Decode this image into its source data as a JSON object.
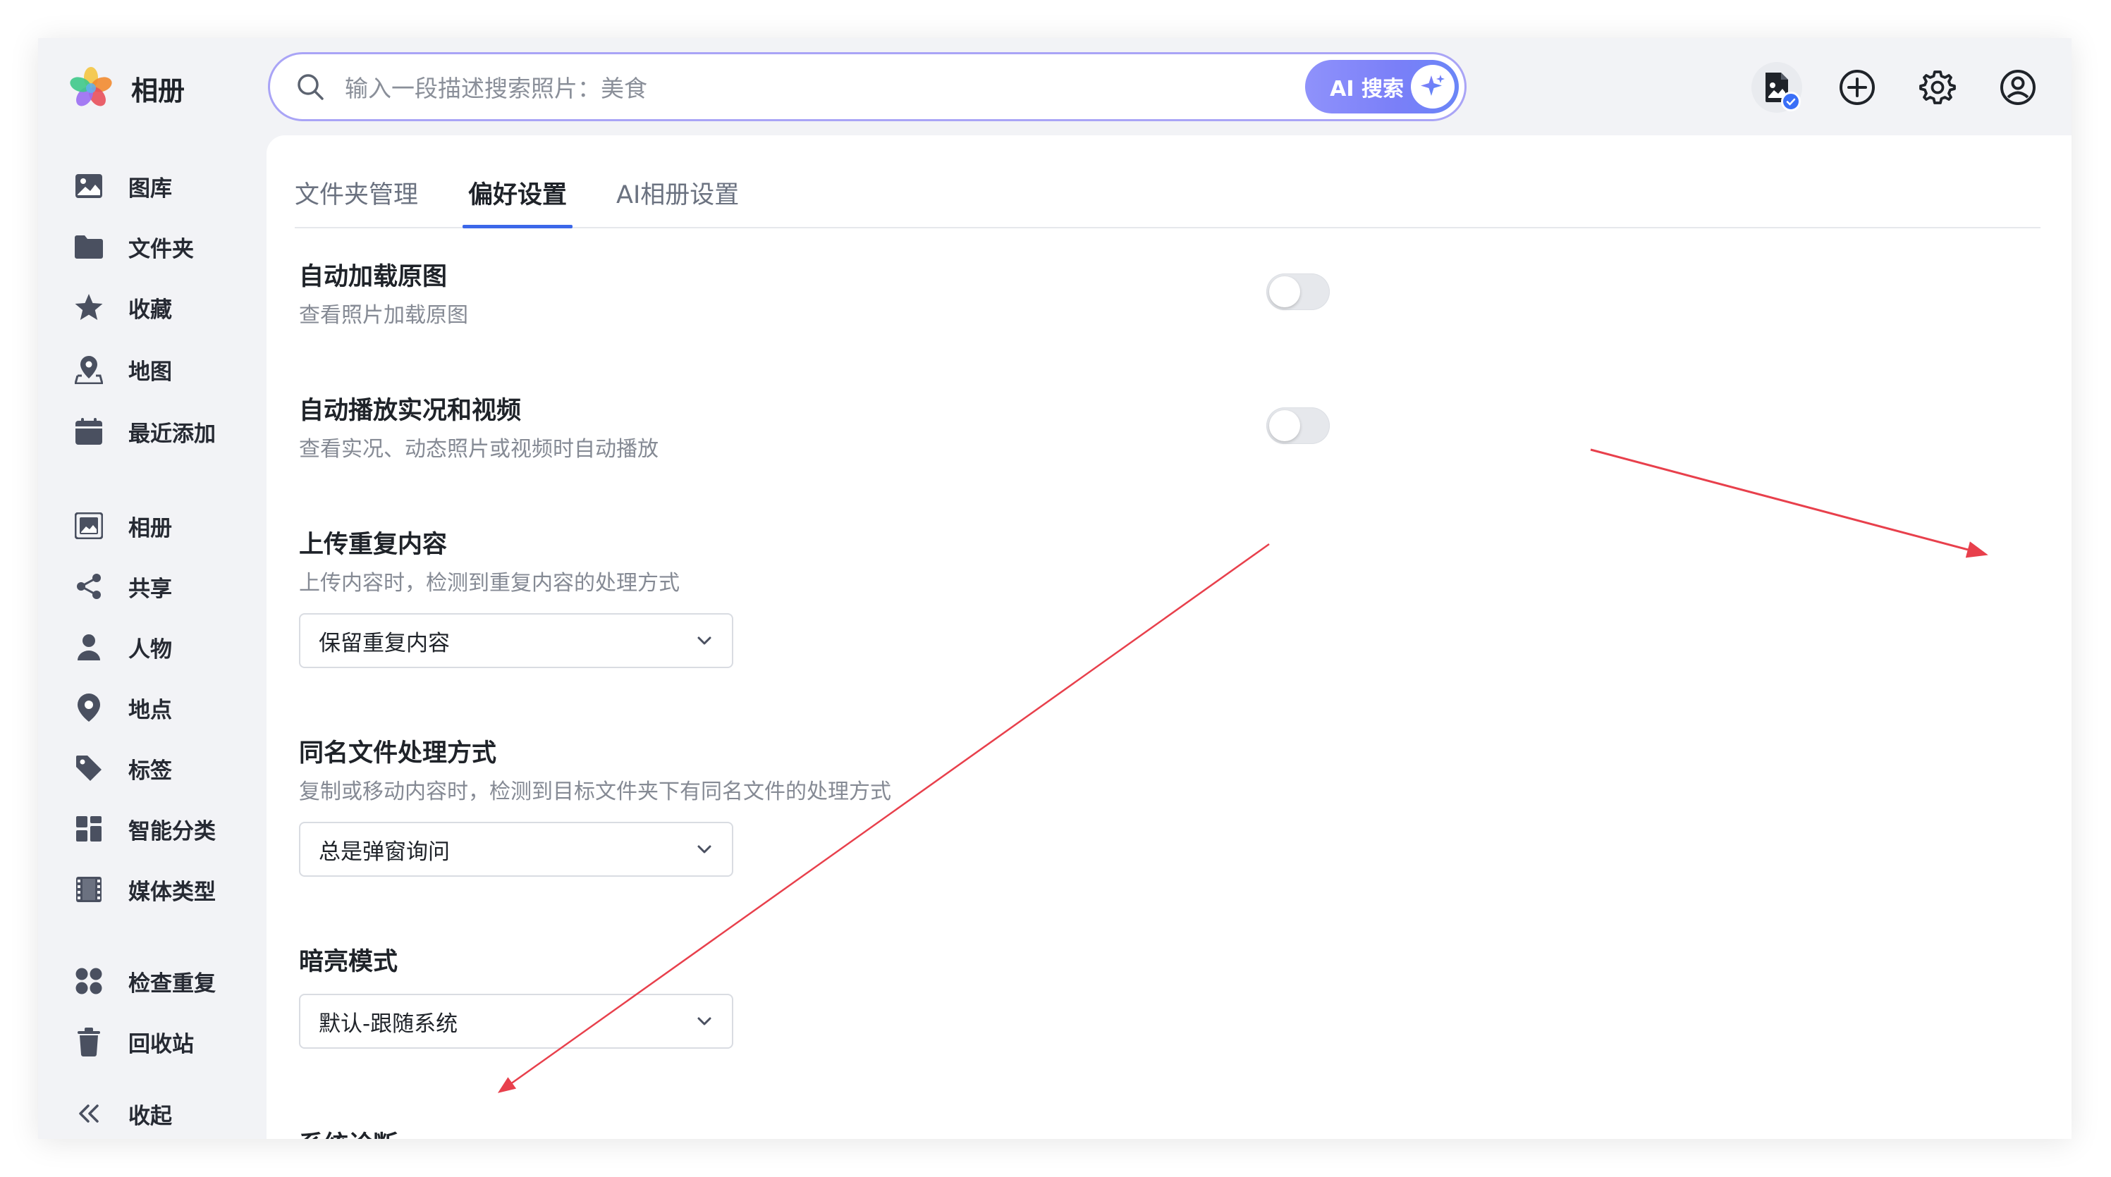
{
  "app": {
    "title": "相册"
  },
  "search": {
    "placeholder": "输入一段描述搜索照片：美食",
    "ai_label": "AI 搜索"
  },
  "topbar": {
    "icons": [
      "file-check-icon",
      "plus-circle-icon",
      "gear-icon",
      "user-circle-icon"
    ]
  },
  "sidebar": {
    "items": [
      {
        "label": "图库",
        "icon": "image-icon"
      },
      {
        "label": "文件夹",
        "icon": "folder-icon"
      },
      {
        "label": "收藏",
        "icon": "star-icon"
      },
      {
        "label": "地图",
        "icon": "map-icon"
      },
      {
        "label": "最近添加",
        "icon": "calendar-icon"
      },
      {
        "label": "相册",
        "icon": "album-icon"
      },
      {
        "label": "共享",
        "icon": "share-icon"
      },
      {
        "label": "人物",
        "icon": "person-icon"
      },
      {
        "label": "地点",
        "icon": "location-icon"
      },
      {
        "label": "标签",
        "icon": "tag-icon"
      },
      {
        "label": "智能分类",
        "icon": "grid-icon"
      },
      {
        "label": "媒体类型",
        "icon": "film-icon"
      },
      {
        "label": "检查重复",
        "icon": "duplicate-icon"
      },
      {
        "label": "回收站",
        "icon": "trash-icon"
      },
      {
        "label": "收起",
        "icon": "collapse-icon"
      }
    ]
  },
  "tabs": [
    {
      "label": "文件夹管理",
      "active": false
    },
    {
      "label": "偏好设置",
      "active": true
    },
    {
      "label": "AI相册设置",
      "active": false
    }
  ],
  "settings": {
    "auto_original": {
      "title": "自动加载原图",
      "desc": "查看照片加载原图",
      "enabled": false
    },
    "autoplay": {
      "title": "自动播放实况和视频",
      "desc": "查看实况、动态照片或视频时自动播放",
      "enabled": false
    },
    "duplicate": {
      "title": "上传重复内容",
      "desc": "上传内容时，检测到重复内容的处理方式",
      "value": "保留重复内容"
    },
    "same_name": {
      "title": "同名文件处理方式",
      "desc": "复制或移动内容时，检测到目标文件夹下有同名文件的处理方式",
      "value": "总是弹窗询问"
    },
    "theme": {
      "title": "暗亮模式",
      "value": "默认-跟随系统"
    },
    "diagnosis": {
      "title": "系统诊断"
    }
  },
  "colors": {
    "accent": "#3b67e9",
    "search_border": "#a9a4f6",
    "annotation": "#e8404c"
  }
}
